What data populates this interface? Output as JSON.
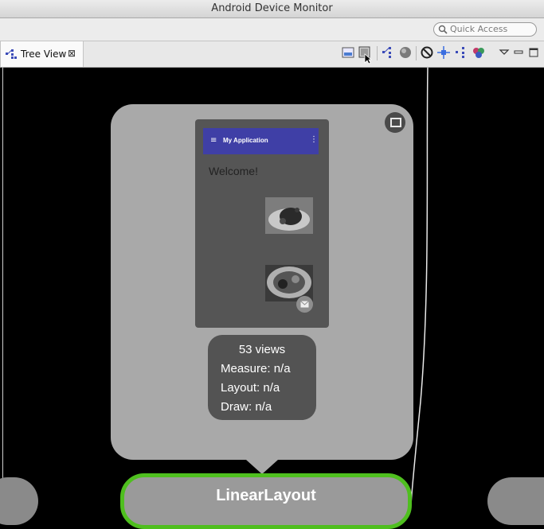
{
  "window": {
    "title": "Android Device Monitor"
  },
  "quick_access": {
    "placeholder": "Quick Access"
  },
  "tab": {
    "label": "Tree View",
    "close_glyph": "⊠"
  },
  "toolbar_icons": [
    "save-as-png-icon",
    "capture-layers-icon",
    "tree-icon",
    "sphere-icon",
    "stop-icon",
    "target-icon",
    "tree-icon",
    "layers-color-icon",
    "view-menu-icon",
    "minimize-icon",
    "maximize-icon"
  ],
  "preview": {
    "app_title": "My Application",
    "menu_glyph": "≡",
    "overflow_glyph": "⋮",
    "welcome_text": "Welcome!"
  },
  "stats": {
    "views": "53 views",
    "measure": "Measure: n/a",
    "layout": "Layout: n/a",
    "draw": "Draw: n/a"
  },
  "node": {
    "label": "LinearLayout"
  },
  "colors": {
    "accent_node_border": "#4fbf1f",
    "app_bar": "#3f3fa6",
    "card_bg": "#a9a9a9",
    "stats_bg": "#535353"
  }
}
